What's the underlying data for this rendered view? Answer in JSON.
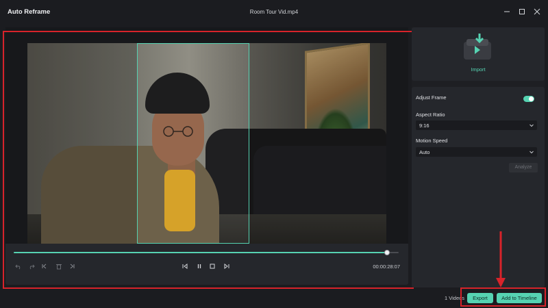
{
  "window": {
    "app_title": "Auto Reframe",
    "file_title": "Room Tour Vid.mp4",
    "controls": [
      "minimize-icon",
      "maximize-icon",
      "close-icon"
    ]
  },
  "player": {
    "timecode": "00:00:28:07",
    "progress_fraction": 0.97,
    "controls": [
      "undo-icon",
      "redo-icon",
      "mark-in-icon",
      "delete-icon",
      "mark-out-icon",
      "prev-frame-icon",
      "pause-icon",
      "stop-icon",
      "next-frame-icon"
    ]
  },
  "sidebar": {
    "import_label": "Import",
    "adjust_frame_label": "Adjust Frame",
    "adjust_frame_on": true,
    "aspect_ratio_label": "Aspect Ratio",
    "aspect_ratio_value": "9:16",
    "motion_speed_label": "Motion Speed",
    "motion_speed_value": "Auto",
    "analyze_label": "Analyze"
  },
  "footer": {
    "videos_count": "1 Videos",
    "export_label": "Export",
    "add_to_timeline_label": "Add to Timeline"
  },
  "colors": {
    "accent": "#56d3b2",
    "annotation": "#d8232a",
    "background": "#1b1c20",
    "panel": "#25272c"
  }
}
